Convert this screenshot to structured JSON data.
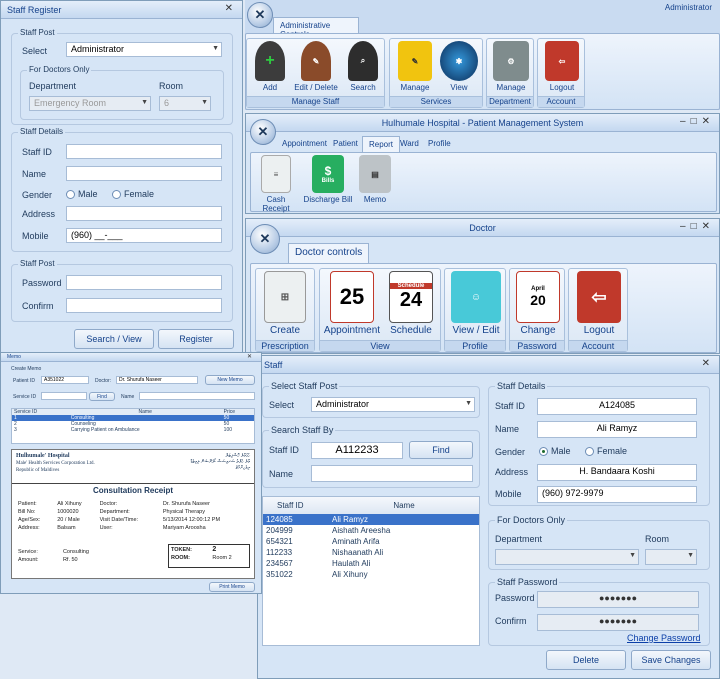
{
  "staff_register": {
    "title": "Staff Register",
    "post_legend": "Staff Post",
    "select_label": "Select",
    "select_value": "Administrator",
    "doctors_legend": "For Doctors Only",
    "dept_label": "Department",
    "room_label": "Room",
    "dept_value": "Emergency Room",
    "room_value": "6",
    "details_legend": "Staff Details",
    "staff_id_label": "Staff ID",
    "name_label": "Name",
    "gender_label": "Gender",
    "male": "Male",
    "female": "Female",
    "address_label": "Address",
    "mobile_label": "Mobile",
    "mobile_value": "(960) __-___",
    "post2_legend": "Staff Post",
    "password_label": "Password",
    "confirm_label": "Confirm",
    "search_view": "Search / View",
    "register": "Register"
  },
  "admin": {
    "title": "Administrator",
    "tab": "Administrative Controls",
    "buttons": [
      "Add",
      "Edit / Delete",
      "Search",
      "Manage",
      "View",
      "Manage",
      "Logout"
    ],
    "groups": [
      "Manage Staff",
      "Services",
      "Department",
      "Account"
    ]
  },
  "pms": {
    "title": "Hulhumale Hospital - Patient Management System",
    "tabs": [
      "Appointment",
      "Patient",
      "Report",
      "Ward",
      "Profile"
    ],
    "buttons": [
      "Cash Receipt",
      "Discharge Bill",
      "Memo"
    ],
    "bills_icon_text": "Bills"
  },
  "doctor": {
    "title": "Doctor",
    "tab": "Doctor controls",
    "buttons": [
      "Create",
      "Appointment",
      "Schedule",
      "View / Edit",
      "Change",
      "Logout"
    ],
    "groups": [
      "Prescription",
      "View",
      "Profile",
      "Password",
      "Account"
    ],
    "appt_icon": "25",
    "sched_icon": "24",
    "sched_header": "Schedule",
    "change_month": "April",
    "change_day": "20"
  },
  "memo": {
    "title": "Memo",
    "create_memo": "Create Memo",
    "patient_id_label": "Patient ID",
    "patient_id": "A351022",
    "doctor_label": "Doctor:",
    "doctor_value": "Dr. Shurufa Naseer",
    "new_memo": "New Memo",
    "service_id_label": "Service ID",
    "find": "Find",
    "name_label": "Name",
    "columns": [
      "Service ID",
      "Name",
      "Price"
    ],
    "rows": [
      [
        "1",
        "Consulting",
        "50"
      ],
      [
        "2",
        "Counseling",
        "50"
      ],
      [
        "3",
        "Carrying Patient on Ambulance",
        "100"
      ]
    ],
    "print_memo": "Print Memo",
    "receipt": {
      "hospital": "Hulhumale' Hospital",
      "corp": "Male' Health Services Corporation Ltd.",
      "country": "Republic of Maldives",
      "thaana_1": "ހުޅުމާލެ ހޮސްޕިޓަލް",
      "thaana_2": "މާލެ ހެލްތު ސަރވިސަސް ކޯޕަރޭޝަން ލިމިޓެޑް",
      "thaana_3": "ދިވެހިރާއްޖެ",
      "heading": "Consultation Receipt",
      "patient_l": "Patient:",
      "patient": "Ali Xihuny",
      "bill_l": "Bill No:",
      "bill": "1000020",
      "age_l": "Age/Sex:",
      "age": "20 / Male",
      "addr_l": "Address:",
      "addr": "Balsam",
      "doctor_l": "Doctor:",
      "doctor": "Dr. Shurufa Naseer",
      "dept_l": "Department:",
      "dept": "Physical Therapy",
      "visit_l": "Visit Date/Time:",
      "visit": "5/13/2014 12:00:12 PM",
      "user_l": "User:",
      "user": "Mariyam Aroosha",
      "service_l": "Service:",
      "service": "Consulting",
      "amount_l": "Amount:",
      "amount": "Rf. 50",
      "token_l": "TOKEN:",
      "token": "2",
      "room_l": "ROOM:",
      "room": "Room 2"
    }
  },
  "staff": {
    "title": "Staff",
    "select_post_legend": "Select Staff Post",
    "select_label": "Select",
    "select_value": "Administrator",
    "search_legend": "Search Staff By",
    "staff_id_label": "Staff ID",
    "staff_id_value": "A112233",
    "find": "Find",
    "name_label": "Name",
    "columns": [
      "Staff ID",
      "Name"
    ],
    "rows": [
      [
        "124085",
        "Ali Ramyz"
      ],
      [
        "204999",
        "Aishath Areesha"
      ],
      [
        "654321",
        "Aminath Arifa"
      ],
      [
        "112233",
        "Nishaanath Ali"
      ],
      [
        "234567",
        "Haulath Ali"
      ],
      [
        "351022",
        "Ali Xihuny"
      ]
    ],
    "details_legend": "Staff Details",
    "d_staff_id_label": "Staff ID",
    "d_staff_id": "A124085",
    "d_name_label": "Name",
    "d_name": "Ali Ramyz",
    "gender_label": "Gender",
    "male": "Male",
    "female": "Female",
    "address_label": "Address",
    "address": "H. Bandaara Koshi",
    "mobile_label": "Mobile",
    "mobile": "(960) 972-9979",
    "doctors_legend": "For Doctors Only",
    "dept_label": "Department",
    "room_label": "Room",
    "pwd_legend": "Staff Password",
    "password_label": "Password",
    "password": "●●●●●●●",
    "confirm_label": "Confirm",
    "confirm": "●●●●●●●",
    "change_password": "Change Password",
    "delete": "Delete",
    "save": "Save Changes"
  }
}
